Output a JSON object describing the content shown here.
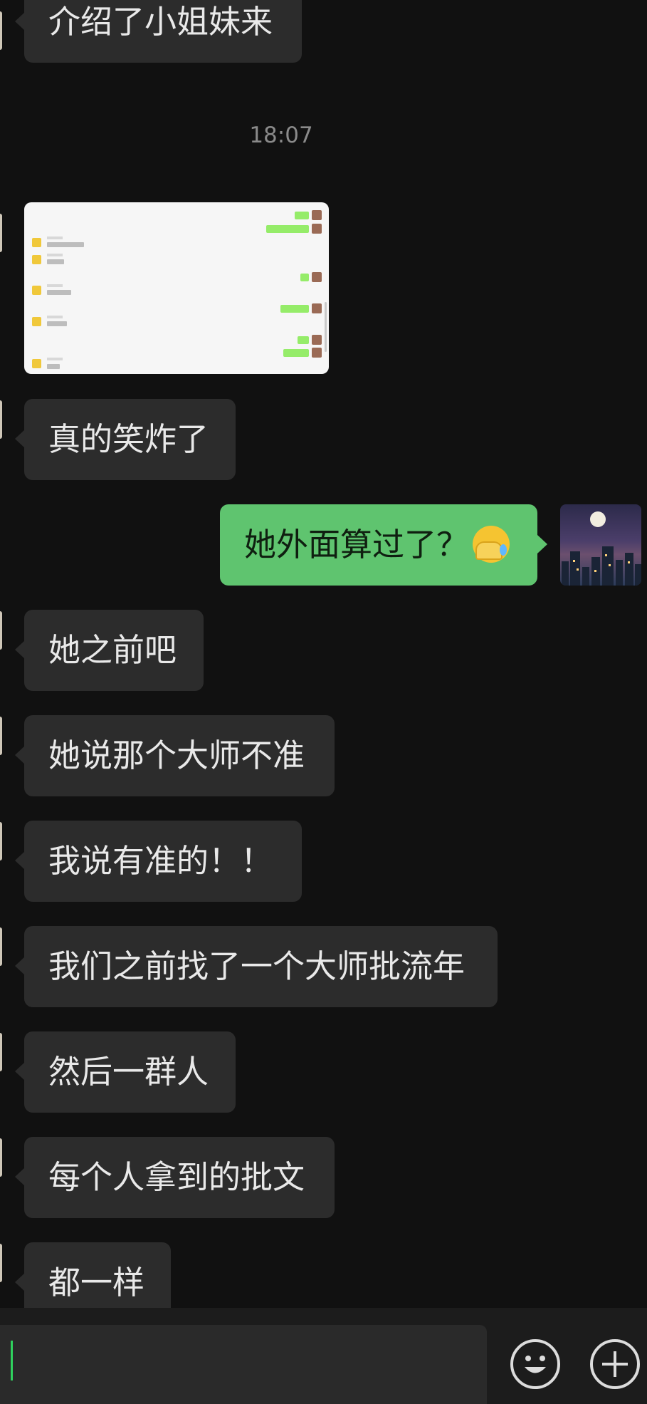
{
  "timestamp": "18:07",
  "messages": [
    {
      "text": "介绍了小姐妹来"
    },
    {
      "text": "真的笑炸了"
    },
    {
      "text": "她外面算过了？"
    },
    {
      "text": "她之前吧"
    },
    {
      "text": "她说那个大师不准"
    },
    {
      "text": "我说有准的！！"
    },
    {
      "text": "我们之前找了一个大师批流年"
    },
    {
      "text": "然后一群人"
    },
    {
      "text": "每个人拿到的批文"
    },
    {
      "text": "都一样"
    }
  ],
  "outgoing_emoji": "facepalm-tears-emoji",
  "screenshot_image": {
    "description_icon": "chat-screenshot-thumbnail"
  },
  "colors": {
    "background": "#111111",
    "incoming_bubble": "#2c2c2c",
    "outgoing_bubble": "#5fc46f",
    "cursor": "#2fd25e"
  },
  "input_bar": {
    "value": "",
    "emoji_icon": "smiley-icon",
    "plus_icon": "plus-icon"
  }
}
